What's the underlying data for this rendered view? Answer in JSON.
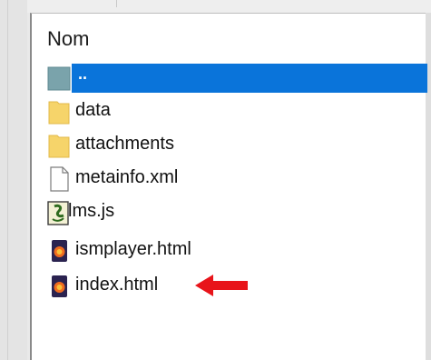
{
  "window": {
    "columns": {
      "name_header": "Nom"
    },
    "files": [
      {
        "name": "..",
        "icon": "folder-up-icon",
        "selected": true
      },
      {
        "name": "data",
        "icon": "folder-icon",
        "selected": false
      },
      {
        "name": "attachments",
        "icon": "folder-icon",
        "selected": false
      },
      {
        "name": "metainfo.xml",
        "icon": "document-icon",
        "selected": false
      },
      {
        "name": "lms.js",
        "icon": "javascript-file-icon",
        "selected": false
      },
      {
        "name": "ismplayer.html",
        "icon": "html-file-icon",
        "selected": false
      },
      {
        "name": "index.html",
        "icon": "html-file-icon",
        "selected": false
      }
    ]
  },
  "annotation": {
    "icon": "red-arrow-icon",
    "color": "#e8141a"
  },
  "colors": {
    "selection": "#0a74da",
    "folder": "#f6d46a"
  }
}
